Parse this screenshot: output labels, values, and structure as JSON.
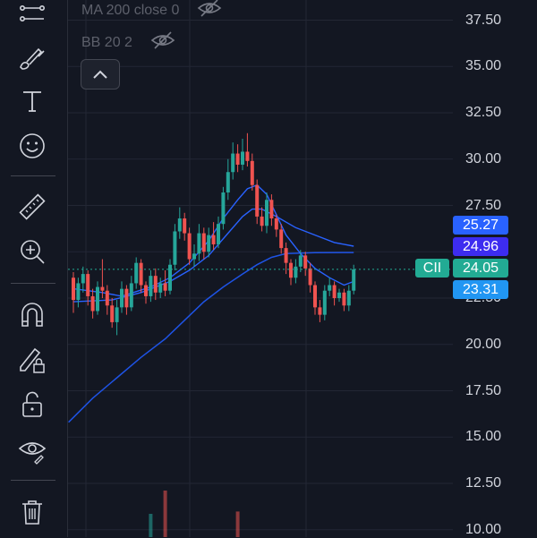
{
  "legend": {
    "ma_label": "MA 200 close 0",
    "bb_label": "BB 20 2"
  },
  "price_axis": {
    "ticks": [
      "37.50",
      "35.00",
      "32.50",
      "30.00",
      "27.50",
      "25.00",
      "22.50",
      "20.00",
      "17.50",
      "15.00",
      "12.50",
      "10.00"
    ],
    "tick_values": [
      37.5,
      35,
      32.5,
      30,
      27.5,
      25,
      22.5,
      20,
      17.5,
      15,
      12.5,
      10
    ]
  },
  "price_tags": [
    {
      "label": "25.27",
      "value": 25.27,
      "color": "#2962ff"
    },
    {
      "label": "24.96",
      "value": 24.96,
      "color": "#3d2cf0"
    },
    {
      "label": "24.05",
      "value": 24.05,
      "color": "#22ab94"
    },
    {
      "label": "23.31",
      "value": 23.31,
      "color": "#2196f3"
    }
  ],
  "symbol_tag": "CII",
  "last_price": 24.05,
  "colors": {
    "up": "#26a69a",
    "down": "#ef5350",
    "bb": "#2962ff",
    "ma": "#1e53e5",
    "grid": "#232734",
    "current_line": "#22ab94"
  },
  "tools": [
    "crosshair-icon",
    "brush-icon",
    "text-icon",
    "emoji-icon",
    "ruler-icon",
    "zoom-icon",
    "magnet-icon",
    "lock-pencil-icon",
    "unlock-icon",
    "eye-icon",
    "trash-icon"
  ],
  "candles": [
    [
      23.6,
      22.4,
      23.9,
      21.7
    ],
    [
      22.4,
      23.3,
      23.6,
      22.0
    ],
    [
      23.3,
      23.8,
      24.2,
      22.8
    ],
    [
      23.8,
      22.6,
      24.0,
      22.1
    ],
    [
      22.6,
      21.8,
      23.0,
      21.4
    ],
    [
      21.8,
      23.1,
      23.4,
      21.6
    ],
    [
      23.1,
      22.9,
      24.6,
      22.5
    ],
    [
      22.9,
      22.1,
      23.2,
      21.6
    ],
    [
      22.1,
      21.2,
      22.5,
      20.9
    ],
    [
      21.2,
      22.0,
      22.4,
      20.5
    ],
    [
      22.0,
      23.0,
      23.4,
      21.7
    ],
    [
      23.0,
      22.0,
      23.2,
      21.6
    ],
    [
      22.0,
      23.3,
      23.7,
      21.8
    ],
    [
      23.3,
      24.4,
      24.7,
      23.0
    ],
    [
      24.4,
      23.2,
      24.6,
      22.8
    ],
    [
      23.2,
      22.6,
      23.4,
      22.2
    ],
    [
      22.6,
      23.7,
      24.0,
      22.3
    ],
    [
      23.7,
      22.8,
      24.1,
      22.4
    ],
    [
      22.8,
      23.3,
      23.6,
      22.5
    ],
    [
      23.3,
      22.9,
      24.0,
      22.6
    ],
    [
      22.9,
      24.3,
      24.6,
      22.7
    ],
    [
      24.3,
      26.1,
      26.5,
      24.0
    ],
    [
      26.1,
      26.8,
      27.4,
      25.7
    ],
    [
      26.8,
      26.0,
      27.1,
      25.6
    ],
    [
      26.0,
      24.6,
      26.3,
      24.3
    ],
    [
      24.6,
      24.9,
      25.4,
      24.2
    ],
    [
      24.9,
      26.0,
      26.5,
      24.5
    ],
    [
      26.0,
      25.0,
      26.3,
      24.6
    ],
    [
      25.0,
      25.9,
      26.3,
      24.7
    ],
    [
      25.9,
      25.4,
      26.6,
      25.1
    ],
    [
      25.4,
      26.5,
      26.9,
      25.2
    ],
    [
      26.5,
      28.2,
      28.5,
      26.2
    ],
    [
      28.2,
      29.3,
      30.0,
      27.8
    ],
    [
      29.3,
      30.3,
      30.9,
      28.9
    ],
    [
      30.3,
      29.7,
      30.8,
      29.3
    ],
    [
      29.7,
      30.4,
      31.1,
      29.4
    ],
    [
      30.4,
      29.9,
      31.4,
      29.6
    ],
    [
      29.9,
      28.6,
      30.3,
      28.3
    ],
    [
      28.6,
      26.9,
      28.9,
      26.5
    ],
    [
      26.9,
      26.4,
      27.4,
      26.1
    ],
    [
      26.4,
      27.8,
      28.2,
      26.0
    ],
    [
      27.8,
      26.8,
      28.1,
      26.4
    ],
    [
      26.8,
      26.2,
      27.0,
      25.8
    ],
    [
      26.2,
      25.2,
      26.5,
      24.9
    ],
    [
      25.2,
      24.4,
      25.5,
      23.8
    ],
    [
      24.4,
      23.6,
      24.6,
      23.2
    ],
    [
      23.6,
      24.2,
      24.6,
      23.3
    ],
    [
      24.2,
      24.8,
      25.1,
      23.9
    ],
    [
      24.8,
      24.1,
      25.0,
      23.7
    ],
    [
      24.1,
      23.2,
      24.4,
      22.8
    ],
    [
      23.2,
      22.0,
      23.4,
      21.6
    ],
    [
      22.0,
      21.6,
      22.4,
      21.2
    ],
    [
      21.6,
      22.9,
      23.2,
      21.3
    ],
    [
      22.9,
      23.2,
      23.6,
      22.6
    ],
    [
      23.2,
      22.5,
      23.4,
      22.1
    ],
    [
      22.5,
      22.8,
      23.0,
      22.3
    ],
    [
      22.8,
      22.1,
      23.0,
      21.8
    ],
    [
      22.1,
      22.9,
      23.2,
      21.8
    ],
    [
      22.9,
      24.05,
      24.3,
      22.7
    ]
  ],
  "bb_upper": [
    [
      0,
      23.0
    ],
    [
      6,
      22.8
    ],
    [
      10,
      22.6
    ],
    [
      16,
      23.1
    ],
    [
      20,
      23.6
    ],
    [
      24,
      24.4
    ],
    [
      28,
      25.6
    ],
    [
      31,
      26.8
    ],
    [
      34,
      27.8
    ],
    [
      36,
      28.4
    ],
    [
      38,
      28.6
    ],
    [
      40,
      28.1
    ],
    [
      42,
      27.0
    ],
    [
      44,
      25.9
    ],
    [
      47,
      24.9
    ],
    [
      50,
      24.1
    ],
    [
      53,
      23.6
    ],
    [
      56,
      23.2
    ],
    [
      58,
      23.4
    ]
  ],
  "bb_middle": [
    [
      0,
      22.3
    ],
    [
      8,
      22.4
    ],
    [
      14,
      22.8
    ],
    [
      20,
      23.4
    ],
    [
      24,
      24.0
    ],
    [
      28,
      24.8
    ],
    [
      32,
      26.0
    ],
    [
      35,
      26.9
    ],
    [
      37,
      27.3
    ],
    [
      39,
      27.3
    ],
    [
      42,
      26.9
    ],
    [
      46,
      26.3
    ],
    [
      50,
      25.9
    ],
    [
      54,
      25.5
    ],
    [
      58,
      25.3
    ]
  ],
  "ma200": [
    [
      -1,
      15.8
    ],
    [
      4,
      17.1
    ],
    [
      9,
      18.2
    ],
    [
      14,
      19.3
    ],
    [
      19,
      20.3
    ],
    [
      23,
      21.3
    ],
    [
      27,
      22.3
    ],
    [
      31,
      23.1
    ],
    [
      35,
      23.8
    ],
    [
      38,
      24.3
    ],
    [
      41,
      24.7
    ],
    [
      44,
      24.9
    ],
    [
      50,
      24.95
    ],
    [
      58,
      24.96
    ]
  ],
  "volume_bars": [
    {
      "i": 16,
      "v": 0.5,
      "c": "#26a69a"
    },
    {
      "i": 19,
      "v": 1.0,
      "c": "#ef5350"
    },
    {
      "i": 34,
      "v": 0.55,
      "c": "#ef5350"
    }
  ]
}
